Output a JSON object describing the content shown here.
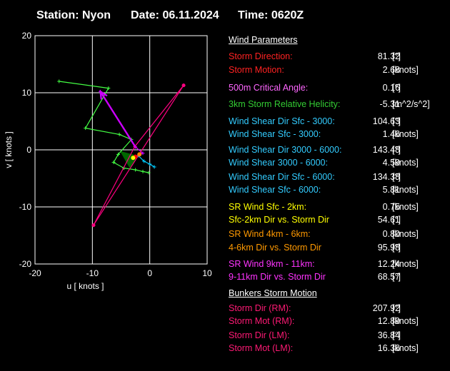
{
  "header": {
    "station_label": "Station: Nyon",
    "date_label": "Date: 06.11.2024",
    "time_label": "Time: 0620Z"
  },
  "chart_data": {
    "type": "hodograph",
    "xlabel": "u  [ knots ]",
    "ylabel": "v  [ knots ]",
    "xlim": [
      -20,
      10
    ],
    "ylim": [
      -20,
      20
    ],
    "xticks": [
      -20,
      -10,
      0,
      10
    ],
    "yticks": [
      -20,
      -10,
      0,
      10,
      20
    ],
    "grid": true,
    "series": [
      {
        "color": "#44ff44",
        "points": [
          [
            -15.8,
            12
          ],
          [
            -7.2,
            10.8
          ],
          [
            -11.2,
            3.8
          ],
          [
            -5.3,
            2.7
          ],
          [
            -3.2,
            1.8
          ],
          [
            -5.5,
            -0.8
          ],
          [
            -6.3,
            -2.2
          ],
          [
            -4.5,
            -3.2
          ],
          [
            -2.5,
            -3.5
          ],
          [
            -1.2,
            -3.8
          ],
          [
            -0.2,
            -4
          ]
        ]
      },
      {
        "color": "#cc00ff",
        "points": [
          [
            -8.6,
            10.2
          ],
          [
            -2.5,
            0.5
          ],
          [
            -1.2,
            -0.6
          ],
          [
            -2.0,
            -1.0
          ]
        ]
      },
      {
        "color": "#00ccff",
        "points": [
          [
            -2.0,
            -1.0
          ],
          [
            -1.0,
            -2.0
          ],
          [
            0.0,
            -2.5
          ],
          [
            0.8,
            -3.0
          ]
        ]
      },
      {
        "color": "#ff0080",
        "points": [
          [
            -9.8,
            -13.2
          ],
          [
            5.9,
            11.3
          ],
          [
            -2.6,
            0.6
          ],
          [
            -9.8,
            -13.2
          ]
        ]
      }
    ],
    "shaded_region": {
      "color": "#006600",
      "points": [
        [
          -5.2,
          -0.2
        ],
        [
          -3.0,
          -0.8
        ],
        [
          -2.0,
          -1.2
        ],
        [
          -3.5,
          -3.2
        ]
      ]
    },
    "markers": [
      {
        "color": "#ff0000",
        "x": -2.5,
        "y": -1.2
      },
      {
        "color": "#ffff00",
        "x": -2.9,
        "y": -1.4
      },
      {
        "color": "#ff8800",
        "x": -1.8,
        "y": -0.8
      }
    ],
    "arrow": {
      "color": "#cc00ff",
      "from": [
        -2.5,
        0.5
      ],
      "to": [
        -8.6,
        10.2
      ]
    }
  },
  "params": {
    "wind_title": "Wind Parameters",
    "bunkers_title": "Bunkers Storm Motion",
    "rows": [
      {
        "label": "Storm Direction:",
        "value": "81.32",
        "unit": "[°]",
        "color": "#ff2222"
      },
      {
        "label": "Storm Motion:",
        "value": "2.68",
        "unit": "[knots]",
        "color": "#ff2222"
      },
      {
        "label": "500m Critical Angle:",
        "value": "0.16",
        "unit": "[°]",
        "color": "#ff66ff"
      },
      {
        "label": "3km Storm Relative Helicity:",
        "value": "-5.31",
        "unit": "[m^2/s^2]",
        "color": "#33cc33"
      },
      {
        "label": "Wind Shear Dir Sfc - 3000:",
        "value": "104.63",
        "unit": "[°]",
        "color": "#33ccff"
      },
      {
        "label": "Wind Shear Sfc - 3000:",
        "value": "1.46",
        "unit": "[knots]",
        "color": "#33ccff"
      },
      {
        "label": "Wind Shear Dir 3000 - 6000:",
        "value": "143.48",
        "unit": "[°]",
        "color": "#33ccff"
      },
      {
        "label": "Wind Shear 3000 - 6000:",
        "value": "4.59",
        "unit": "[knots]",
        "color": "#33ccff"
      },
      {
        "label": "Wind Shear Dir Sfc - 6000:",
        "value": "134.38",
        "unit": "[°]",
        "color": "#33ccff"
      },
      {
        "label": "Wind Shear Sfc - 6000:",
        "value": "5.81",
        "unit": "[knots]",
        "color": "#33ccff"
      },
      {
        "label": "SR Wind Sfc - 2km:",
        "value": "0.75",
        "unit": "[knots]",
        "color": "#ffff00"
      },
      {
        "label": "Sfc-2km Dir vs. Storm Dir",
        "value": "54.61",
        "unit": "[°]",
        "color": "#ffff00"
      },
      {
        "label": "SR Wind 4km - 6km:",
        "value": "0.80",
        "unit": "[knots]",
        "color": "#ff9900"
      },
      {
        "label": "4-6km Dir vs. Storm Dir",
        "value": "95.98",
        "unit": "[°]",
        "color": "#ff9900"
      },
      {
        "label": "SR Wind 9km - 11km:",
        "value": "12.24",
        "unit": "[knots]",
        "color": "#ff33ff"
      },
      {
        "label": "9-11km Dir vs. Storm Dir",
        "value": "68.57",
        "unit": "[°]",
        "color": "#ff33ff"
      },
      {
        "label": "Storm Dir (RM):",
        "value": "207.92",
        "unit": "[°]",
        "color": "#ff1a75"
      },
      {
        "label": "Storm Mot (RM):",
        "value": "12.89",
        "unit": "[knots]",
        "color": "#ff1a75"
      },
      {
        "label": "Storm Dir (LM):",
        "value": "36.84",
        "unit": "[°]",
        "color": "#ff1a75"
      },
      {
        "label": "Storm Mot (LM):",
        "value": "16.36",
        "unit": "[knots]",
        "color": "#ff1a75"
      }
    ]
  }
}
